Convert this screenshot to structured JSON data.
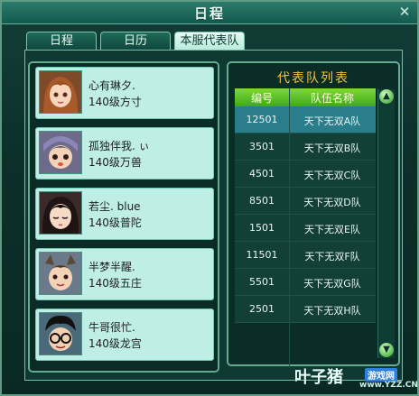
{
  "window": {
    "title": "日程",
    "close_symbol": "✕"
  },
  "tabs": [
    {
      "label": "日程"
    },
    {
      "label": "日历"
    },
    {
      "label": "本服代表队"
    }
  ],
  "members": [
    {
      "name": "心有琳夕.",
      "info": "140级方寸"
    },
    {
      "name": "孤独伴我. ぃ",
      "info": "140级万兽"
    },
    {
      "name": "若尘. blue",
      "info": "140级普陀"
    },
    {
      "name": "半梦半醒.",
      "info": "140级五庄"
    },
    {
      "name": "牛哥很忙.",
      "info": "140级龙宫"
    }
  ],
  "team_list": {
    "heading": "代表队列表",
    "columns": {
      "number": "编号",
      "team": "队伍名称"
    },
    "rows": [
      {
        "number": "12501",
        "team": "天下无双A队"
      },
      {
        "number": "3501",
        "team": "天下无双B队"
      },
      {
        "number": "4501",
        "team": "天下无双C队"
      },
      {
        "number": "8501",
        "team": "天下无双D队"
      },
      {
        "number": "1501",
        "team": "天下无双E队"
      },
      {
        "number": "11501",
        "team": "天下无双F队"
      },
      {
        "number": "5501",
        "team": "天下无双G队"
      },
      {
        "number": "2501",
        "team": "天下无双H队"
      }
    ],
    "selected_row": 0
  },
  "watermark": {
    "text": "叶子猪",
    "badge": "游戏网",
    "url": "www.YZZ.CN"
  }
}
